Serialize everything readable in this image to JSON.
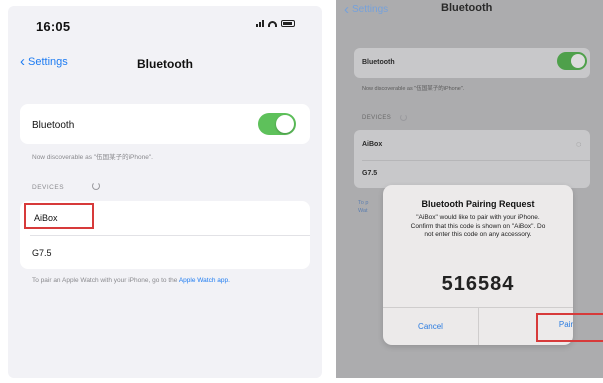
{
  "left": {
    "status_time": "16:05",
    "back_label": "Settings",
    "title": "Bluetooth",
    "bluetooth_label": "Bluetooth",
    "discoverable_text": "Now discoverable as \"伍国某子的iPhone\".",
    "devices_header": "DEVICES",
    "devices": [
      "AiBox",
      "G7.5"
    ],
    "footer_text": "To pair an Apple Watch with your iPhone, go to the",
    "footer_link": "Apple Watch app."
  },
  "right": {
    "back_label": "Settings",
    "title": "Bluetooth",
    "bluetooth_label": "Bluetooth",
    "discoverable_text": "Now discoverable as \"伍国某子的iPhone\".",
    "devices_header": "DEVICES",
    "devices": [
      "AiBox",
      "G7.5"
    ],
    "footer_left": "To p\nWat",
    "footer_right": "ple",
    "alert": {
      "title": "Bluetooth Pairing Request",
      "message": "\"AiBox\" would like to pair with your iPhone. Confirm that this code is shown on \"AiBox\". Do not enter this code on any accessory.",
      "code": "516584",
      "cancel_label": "Cancel",
      "pair_label": "Pair"
    }
  },
  "colors": {
    "accent": "#1e7cf2",
    "toggle_on": "#5ec15b",
    "highlight": "#d73a3a"
  }
}
